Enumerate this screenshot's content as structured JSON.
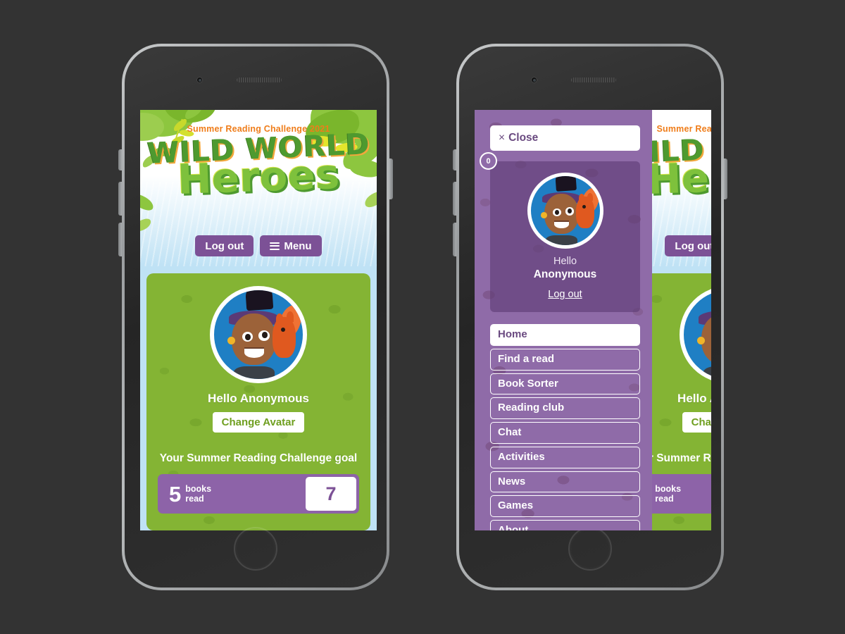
{
  "page": {
    "background_color": "#333333",
    "brand_purple": "#7c5196",
    "brand_green": "#84b434",
    "brand_orange": "#ef8b33",
    "sky_blue": "#bfe2f5"
  },
  "site_header": {
    "strapline": "Summer Reading Challenge 2021",
    "logo_line1": "WILD WORLD",
    "logo_line2": "Heroes",
    "logout_label": "Log out",
    "menu_label": "Menu",
    "menu_icon": "hamburger-icon"
  },
  "home": {
    "avatar_alt": "user-avatar",
    "greeting": "Hello Anonymous",
    "change_avatar_label": "Change Avatar",
    "goal_title": "Your Summer Reading Challenge goal",
    "books_read": "5",
    "books_read_label_line1": "books",
    "books_read_label_line2": "read",
    "goal_total": "7"
  },
  "menu_overlay": {
    "close_label": "Close",
    "close_icon": "×",
    "badge_count": "0",
    "profile_hello": "Hello",
    "profile_name": "Anonymous",
    "profile_logout": "Log out",
    "items": [
      {
        "label": "Home",
        "active": true
      },
      {
        "label": "Find a read",
        "active": false
      },
      {
        "label": "Book Sorter",
        "active": false
      },
      {
        "label": "Reading club",
        "active": false
      },
      {
        "label": "Chat",
        "active": false
      },
      {
        "label": "Activities",
        "active": false
      },
      {
        "label": "News",
        "active": false
      },
      {
        "label": "Games",
        "active": false
      },
      {
        "label": "About",
        "active": false
      }
    ]
  },
  "devices": [
    {
      "name": "phone-left",
      "state": "home-screen"
    },
    {
      "name": "phone-right",
      "state": "menu-open"
    }
  ]
}
